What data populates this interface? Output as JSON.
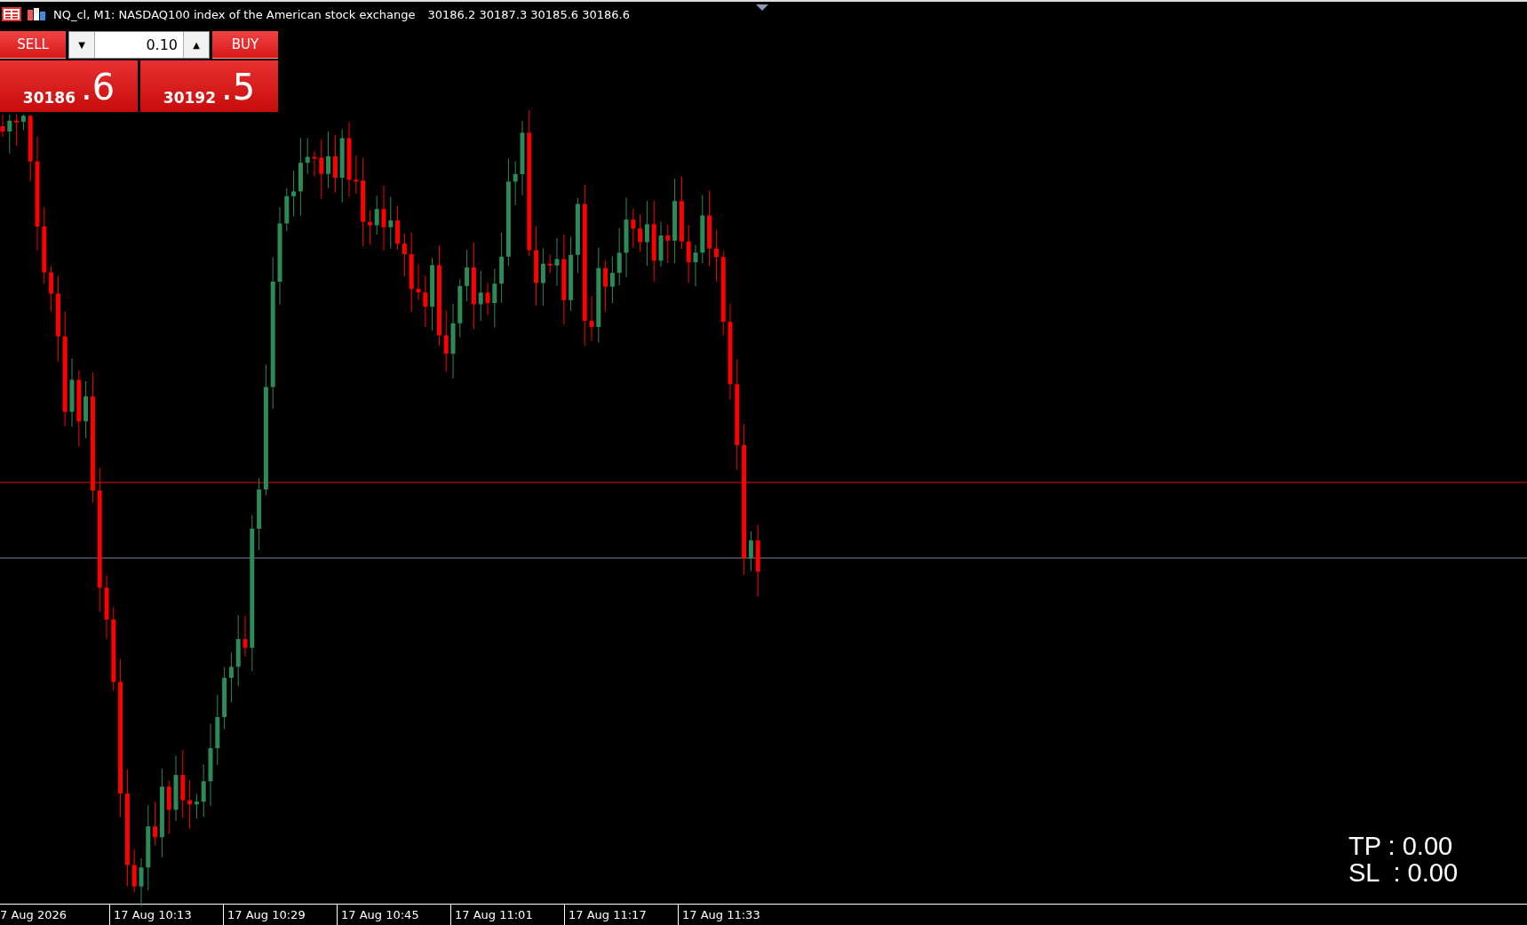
{
  "chart_window": {
    "title": "NQ_cl, M1:  NASDAQ100 index of the American stock exchange",
    "quote": "30186.2 30187.3 30185.6 30186.6"
  },
  "trade_panel": {
    "sell_label": "SELL",
    "buy_label": "BUY",
    "volume": "0.10",
    "down_arrow": "▼",
    "up_arrow": "▲",
    "sell_price": {
      "main": "30186",
      "fraction": ".6"
    },
    "buy_price": {
      "main": "30192",
      "fraction": ".5"
    }
  },
  "time_axis": [
    "7 Aug 2026",
    "17 Aug 10:13",
    "17 Aug 10:29",
    "17 Aug 10:45",
    "17 Aug 11:01",
    "17 Aug 11:17",
    "17 Aug 11:33"
  ],
  "levels": [
    {
      "label": "TP : 0.00"
    },
    {
      "label": "SL  : 0.00"
    }
  ]
}
